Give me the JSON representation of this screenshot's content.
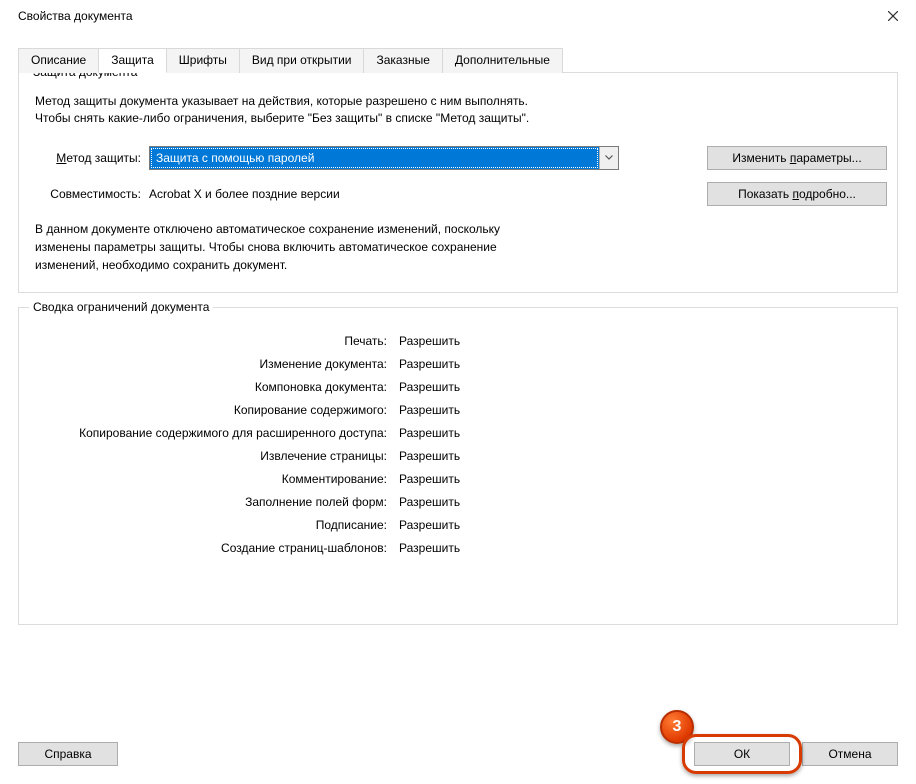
{
  "window": {
    "title": "Свойства документа"
  },
  "tabs": [
    {
      "label": "Описание"
    },
    {
      "label": "Защита"
    },
    {
      "label": "Шрифты"
    },
    {
      "label": "Вид при открытии"
    },
    {
      "label": "Заказные"
    },
    {
      "label": "Дополнительные"
    }
  ],
  "active_tab_index": 1,
  "security_group": {
    "legend": "Защита документа",
    "intro_line1": "Метод защиты документа указывает на действия, которые разрешено с ним выполнять.",
    "intro_line2": "Чтобы снять какие-либо ограничения, выберите \"Без защиты\" в списке \"Метод защиты\".",
    "method_label_underlined": "М",
    "method_label_rest": "етод защиты:",
    "method_selected": "Защита с помощью паролей",
    "change_params_pre": "Изменить ",
    "change_params_under": "п",
    "change_params_post": "араметры...",
    "compat_label": "Совместимость:",
    "compat_value": "Acrobat X и более поздние версии",
    "details_pre": "Показать ",
    "details_under": "п",
    "details_post": "одробно...",
    "note": "В данном документе отключено автоматическое сохранение изменений, поскольку изменены параметры защиты. Чтобы снова включить автоматическое сохранение изменений, необходимо сохранить документ."
  },
  "restrictions_group": {
    "legend": "Сводка ограничений документа",
    "rows": [
      {
        "label": "Печать:",
        "value": "Разрешить"
      },
      {
        "label": "Изменение документа:",
        "value": "Разрешить"
      },
      {
        "label": "Компоновка документа:",
        "value": "Разрешить"
      },
      {
        "label": "Копирование содержимого:",
        "value": "Разрешить"
      },
      {
        "label": "Копирование содержимого для расширенного доступа:",
        "value": "Разрешить"
      },
      {
        "label": "Извлечение страницы:",
        "value": "Разрешить"
      },
      {
        "label": "Комментирование:",
        "value": "Разрешить"
      },
      {
        "label": "Заполнение полей форм:",
        "value": "Разрешить"
      },
      {
        "label": "Подписание:",
        "value": "Разрешить"
      },
      {
        "label": "Создание страниц-шаблонов:",
        "value": "Разрешить"
      }
    ]
  },
  "buttons": {
    "help": "Справка",
    "ok": "ОК",
    "cancel": "Отмена"
  },
  "annotation": {
    "step_number": "3"
  }
}
